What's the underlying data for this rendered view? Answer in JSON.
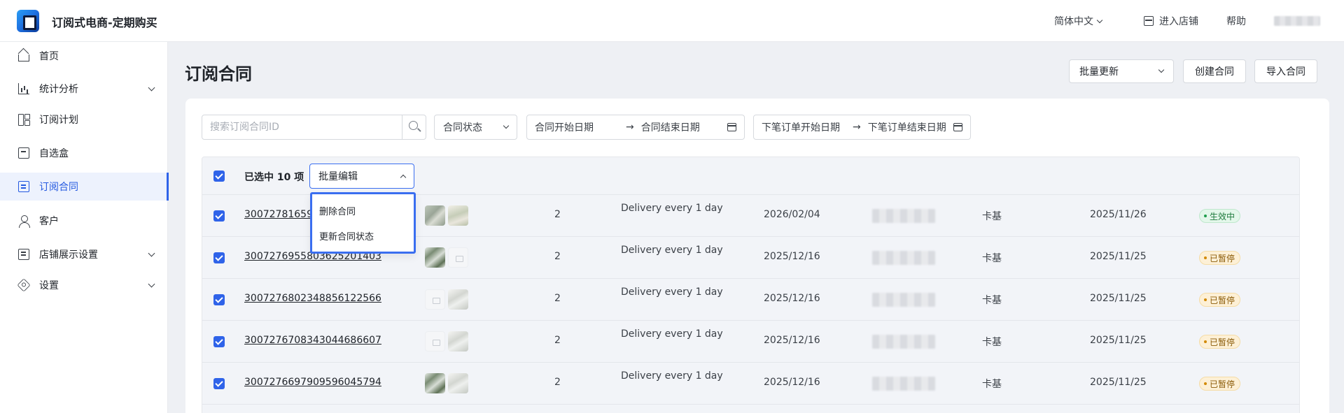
{
  "app": {
    "title": "订阅式电商-定期购买"
  },
  "header": {
    "language": "简体中文",
    "enter_store": "进入店铺",
    "help": "帮助"
  },
  "sidebar": {
    "items": [
      {
        "label": "首页",
        "icon": "home-icon"
      },
      {
        "label": "统计分析",
        "icon": "chart-icon",
        "expandable": true
      },
      {
        "label": "订阅计划",
        "icon": "plan-icon"
      },
      {
        "label": "自选盒",
        "icon": "box-icon"
      },
      {
        "label": "订阅合同",
        "icon": "contract-icon",
        "active": true
      },
      {
        "label": "客户",
        "icon": "user-icon"
      },
      {
        "label": "店铺展示设置",
        "icon": "shop-icon",
        "expandable": true
      },
      {
        "label": "设置",
        "icon": "gear-icon",
        "expandable": true
      }
    ]
  },
  "main": {
    "title": "订阅合同",
    "bulk_update": "批量更新",
    "create": "创建合同",
    "import": "导入合同"
  },
  "filters": {
    "search_placeholder": "搜索订阅合同ID",
    "status": "合同状态",
    "contract_start": "合同开始日期",
    "contract_end": "合同结束日期",
    "order_start": "下笔订单开始日期",
    "order_end": "下笔订单结束日期",
    "arrow": "→"
  },
  "table": {
    "selected_text": "已选中 10 项",
    "bulk_edit": "批量编辑",
    "rows": [
      {
        "id": "30072781659",
        "qty": "2",
        "freq": "Delivery every 1 day",
        "next_date": "2026/02/04",
        "city": "卡基",
        "created": "2025/11/26",
        "status": "生效中"
      },
      {
        "id": "300727695580362520140​3",
        "qty": "2",
        "freq": "Delivery every 1 day",
        "next_date": "2025/12/16",
        "city": "卡基",
        "created": "2025/11/25",
        "status": "已暂停"
      },
      {
        "id": "300727680234885612256​6",
        "qty": "2",
        "freq": "Delivery every 1 day",
        "next_date": "2025/12/16",
        "city": "卡基",
        "created": "2025/11/25",
        "status": "已暂停"
      },
      {
        "id": "300727670834304468660​7",
        "qty": "2",
        "freq": "Delivery every 1 day",
        "next_date": "2025/12/16",
        "city": "卡基",
        "created": "2025/11/25",
        "status": "已暂停"
      },
      {
        "id": "300727669790959604579​4",
        "qty": "2",
        "freq": "Delivery every 1 day",
        "next_date": "2025/12/16",
        "city": "卡基",
        "created": "2025/11/25",
        "status": "已暂停"
      }
    ]
  },
  "dropdown": {
    "items": [
      "删除合同",
      "更新合同状态"
    ]
  },
  "colors": {
    "accent": "#2f63e9",
    "active_badge": "#1f9d4c",
    "paused_badge": "#d28a06"
  }
}
